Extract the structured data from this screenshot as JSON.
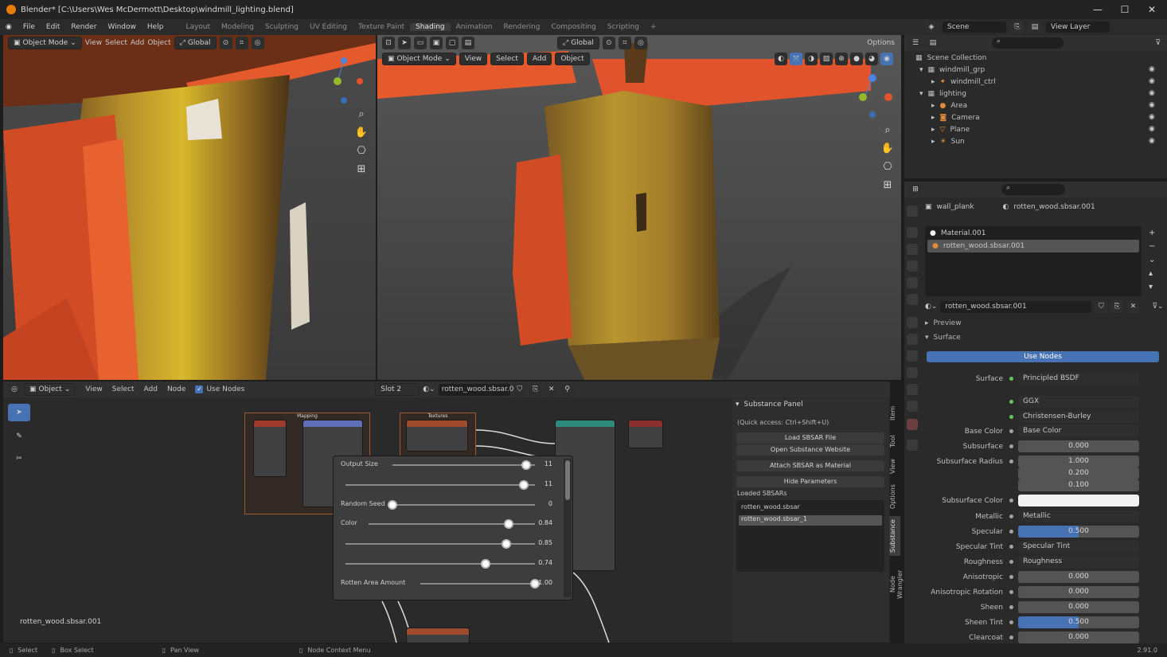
{
  "window": {
    "title": "Blender* [C:\\Users\\Wes McDermott\\Desktop\\windmill_lighting.blend]",
    "min": "—",
    "max": "☐",
    "close": "✕"
  },
  "menu": [
    "File",
    "Edit",
    "Render",
    "Window",
    "Help"
  ],
  "workspaces": [
    "Layout",
    "Modeling",
    "Sculpting",
    "UV Editing",
    "Texture Paint",
    "Shading",
    "Animation",
    "Rendering",
    "Compositing",
    "Scripting"
  ],
  "scene": {
    "label": "Scene",
    "view_layer": "View Layer"
  },
  "vp_left": {
    "mode": "Object Mode",
    "view": "View",
    "select": "Select",
    "add": "Add",
    "object": "Object",
    "orientation": "Global"
  },
  "vp_right": {
    "mode": "Object Mode",
    "view": "View",
    "select": "Select",
    "add": "Add",
    "object": "Object",
    "orientation": "Global",
    "options": "Options"
  },
  "outliner": {
    "root": "Scene Collection",
    "items": [
      {
        "name": "windmill_grp",
        "indent": 1
      },
      {
        "name": "windmill_ctrl",
        "indent": 2
      },
      {
        "name": "lighting",
        "indent": 1
      },
      {
        "name": "Area",
        "indent": 2
      },
      {
        "name": "Camera",
        "indent": 2
      },
      {
        "name": "Plane",
        "indent": 2
      },
      {
        "name": "Sun",
        "indent": 2
      }
    ]
  },
  "props": {
    "object": "wall_plank",
    "material_ref": "rotten_wood.sbsar.001",
    "slots": [
      "Material.001",
      "rotten_wood.sbsar.001"
    ],
    "material_name": "rotten_wood.sbsar.001",
    "preview": "Preview",
    "surface": "Surface",
    "use_nodes": "Use Nodes",
    "rows": [
      {
        "label": "Surface",
        "type": "link",
        "value": "Principled BSDF"
      },
      {
        "label": "",
        "type": "link",
        "value": "GGX"
      },
      {
        "label": "",
        "type": "link",
        "value": "Christensen-Burley"
      },
      {
        "label": "Base Color",
        "type": "link",
        "value": "Base Color"
      },
      {
        "label": "Subsurface",
        "type": "num",
        "value": "0.000"
      },
      {
        "label": "Subsurface Radius",
        "type": "num",
        "value": "1.000"
      },
      {
        "label": "",
        "type": "num",
        "value": "0.200"
      },
      {
        "label": "",
        "type": "num",
        "value": "0.100"
      },
      {
        "label": "Subsurface Color",
        "type": "color",
        "value": ""
      },
      {
        "label": "Metallic",
        "type": "link",
        "value": "Metallic"
      },
      {
        "label": "Specular",
        "type": "blue",
        "value": "0.500"
      },
      {
        "label": "Specular Tint",
        "type": "link",
        "value": "Specular Tint"
      },
      {
        "label": "Roughness",
        "type": "link",
        "value": "Roughness"
      },
      {
        "label": "Anisotropic",
        "type": "num",
        "value": "0.000"
      },
      {
        "label": "Anisotropic Rotation",
        "type": "num",
        "value": "0.000"
      },
      {
        "label": "Sheen",
        "type": "num",
        "value": "0.000"
      },
      {
        "label": "Sheen Tint",
        "type": "blue",
        "value": "0.500"
      },
      {
        "label": "Clearcoat",
        "type": "num",
        "value": "0.000"
      }
    ]
  },
  "node_editor": {
    "object": "Object",
    "view": "View",
    "select": "Select",
    "add": "Add",
    "node": "Node",
    "use_nodes": "Use Nodes",
    "slot": "Slot 2",
    "material": "rotten_wood.sbsar.0...",
    "footer_name": "rotten_wood.sbsar.001",
    "node_titles": [
      "Mapping",
      "Textures"
    ]
  },
  "substance": {
    "title": "Substance Panel",
    "quick": "(Quick access: Ctrl+Shift+U)",
    "buttons": [
      "Load SBSAR File",
      "Open Substance Website",
      "Attach SBSAR as Material",
      "Hide Parameters"
    ],
    "loaded_label": "Loaded SBSARs",
    "loaded": [
      "rotten_wood.sbsar",
      "rotten_wood.sbsar_1"
    ]
  },
  "params": [
    {
      "label": "Output Size",
      "value": "11",
      "pos": 0.94
    },
    {
      "label": "",
      "value": "11",
      "pos": 0.94
    },
    {
      "label": "Random Seed",
      "value": "0",
      "pos": 0.0
    },
    {
      "label": "Color",
      "value": "0.84",
      "pos": 0.84
    },
    {
      "label": "",
      "value": "0.85",
      "pos": 0.85
    },
    {
      "label": "",
      "value": "0.74",
      "pos": 0.74
    },
    {
      "label": "Rotten Area Amount",
      "value": "1.00",
      "pos": 1.0
    }
  ],
  "sidetabs": [
    "Item",
    "Tool",
    "View",
    "Options",
    "Substance",
    "Node Wrangler"
  ],
  "status": {
    "select": "Select",
    "box": "Box Select",
    "pan": "Pan View",
    "ctx": "Node Context Menu",
    "version": "2.91.0"
  }
}
